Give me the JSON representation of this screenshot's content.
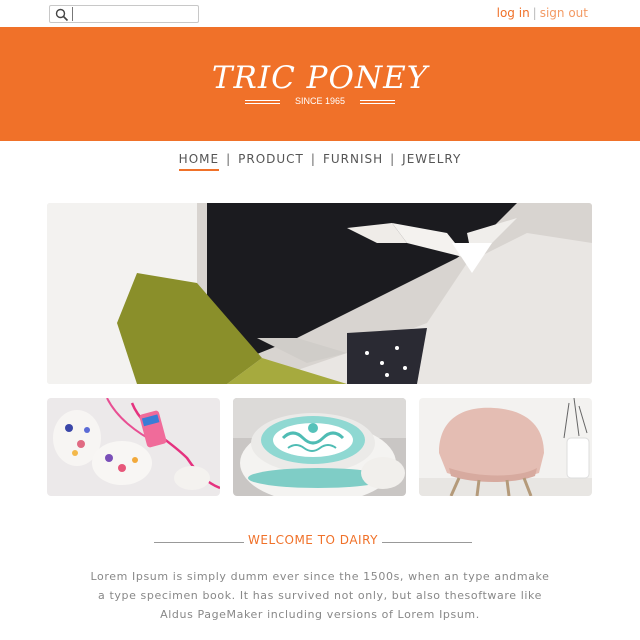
{
  "header": {
    "search": {
      "value": "",
      "placeholder": ""
    },
    "login_label": "log in",
    "separator": "|",
    "signout_label": "sign out"
  },
  "banner": {
    "brand": "TRIC PONEY",
    "since": "SINCE 1965",
    "background": "#f07129"
  },
  "nav": {
    "items": [
      {
        "label": "HOME",
        "active": true
      },
      {
        "label": "PRODUCT",
        "active": false
      },
      {
        "label": "FURNISH",
        "active": false
      },
      {
        "label": "JEWELRY",
        "active": false
      }
    ],
    "separator": "|"
  },
  "gallery": {
    "hero": {
      "icon": "decor-photo"
    },
    "thumbnails": [
      {
        "icon": "jewelry-photo"
      },
      {
        "icon": "bowls-photo"
      },
      {
        "icon": "chair-photo"
      }
    ]
  },
  "welcome": {
    "title": "WELCOME TO DAIRY",
    "body_lines": [
      "Lorem Ipsum is simply dumm ever since the 1500s, when an type andmake",
      "a type specimen book. It has survived not only, but also thesoftware like",
      "Aldus PageMaker including versions of Lorem Ipsum."
    ]
  },
  "colors": {
    "accent": "#f07129",
    "text": "#888888"
  }
}
